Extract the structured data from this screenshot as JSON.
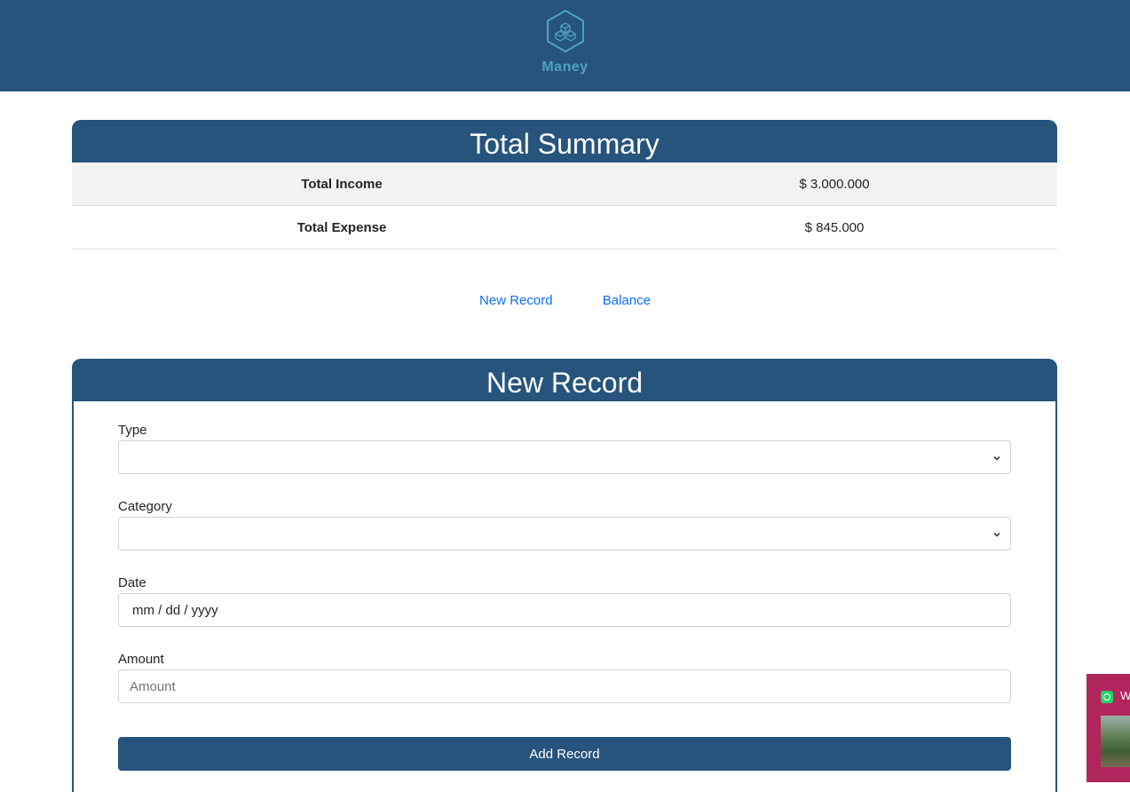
{
  "header": {
    "brand_name": "Maney",
    "logo_icon": "hexagon-cubes-icon",
    "background_color": "#26547c",
    "brand_color": "#4fa3bf"
  },
  "summary": {
    "title": "Total Summary",
    "rows": [
      {
        "label": "Total Income",
        "value": "$ 3.000.000"
      },
      {
        "label": "Total Expense",
        "value": "$ 845.000"
      }
    ]
  },
  "nav": {
    "new_record": "New Record",
    "balance": "Balance",
    "link_color": "#0d6efd"
  },
  "record_form": {
    "title": "New Record",
    "type_label": "Type",
    "type_value": "",
    "category_label": "Category",
    "category_value": "",
    "date_label": "Date",
    "date_placeholder": "mm / dd / yyyy",
    "amount_label": "Amount",
    "amount_placeholder": "Amount",
    "submit_label": "Add Record"
  },
  "widget": {
    "icon": "whatsapp-icon",
    "text": "W",
    "background_color": "#b1265c"
  }
}
